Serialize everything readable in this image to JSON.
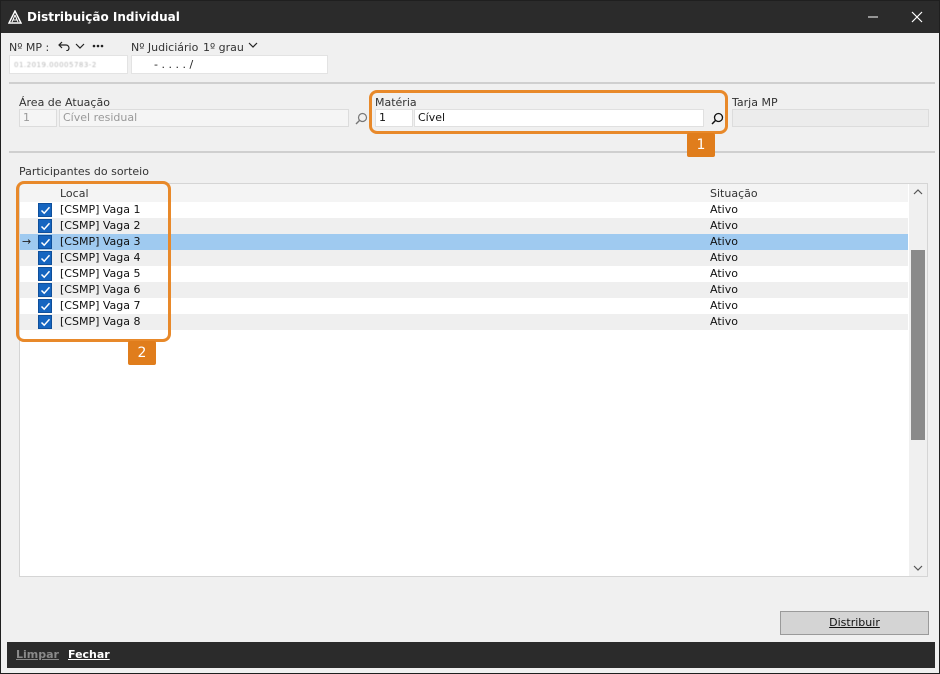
{
  "window": {
    "title": "Distribuição Individual"
  },
  "header": {
    "mp_label": "Nº MP :",
    "mp_value": "01.2019.00005783-2",
    "judicial_label": "Nº Judiciário",
    "grau": "1º grau",
    "judicial_value": "-  .  .  .  .  /"
  },
  "area": {
    "label": "Área de Atuação",
    "code": "1",
    "name": "Cível residual"
  },
  "materia": {
    "label": "Matéria",
    "code": "1",
    "name": "Cível"
  },
  "tarja": {
    "label": "Tarja MP",
    "value": ""
  },
  "participants": {
    "section_label": "Participantes do sorteio",
    "columns": {
      "local": "Local",
      "situacao": "Situação"
    },
    "rows": [
      {
        "local": "[CSMP] Vaga 1",
        "situacao": "Ativo"
      },
      {
        "local": "[CSMP] Vaga 2",
        "situacao": "Ativo"
      },
      {
        "local": "[CSMP] Vaga 3",
        "situacao": "Ativo"
      },
      {
        "local": "[CSMP] Vaga 4",
        "situacao": "Ativo"
      },
      {
        "local": "[CSMP] Vaga 5",
        "situacao": "Ativo"
      },
      {
        "local": "[CSMP] Vaga 6",
        "situacao": "Ativo"
      },
      {
        "local": "[CSMP] Vaga 7",
        "situacao": "Ativo"
      },
      {
        "local": "[CSMP] Vaga 8",
        "situacao": "Ativo"
      }
    ],
    "selected_index": 2
  },
  "callouts": {
    "one": "1",
    "two": "2"
  },
  "buttons": {
    "distribuir": "Distribuir",
    "limpar": "Limpar",
    "fechar": "Fechar"
  },
  "colors": {
    "accent": "#e8892a",
    "selection": "#9fcaf0",
    "checkbox": "#1565c0",
    "titlebar": "#2b2b2b"
  }
}
